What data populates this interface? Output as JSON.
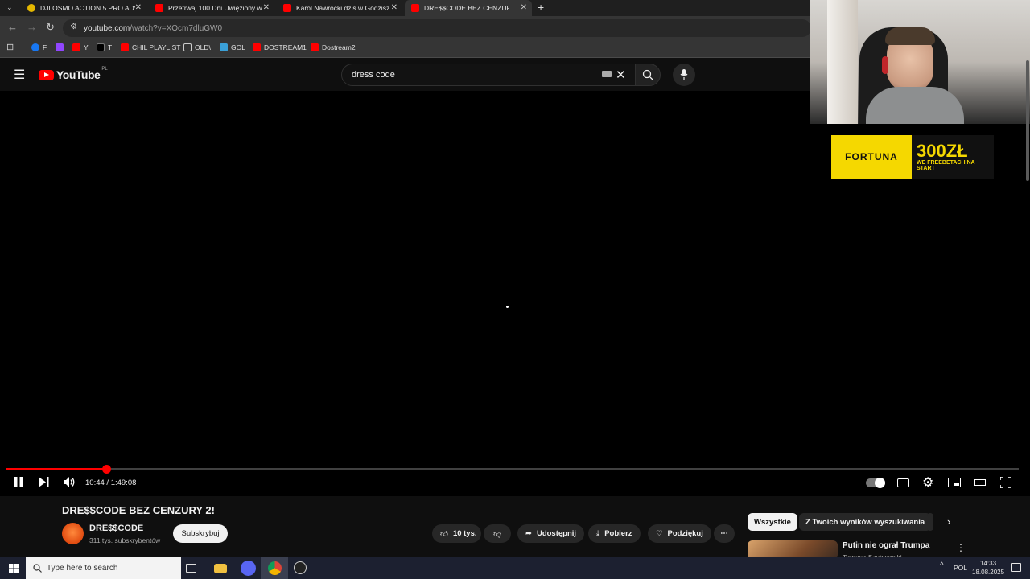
{
  "browser": {
    "tabs": [
      {
        "title": "DJI OSMO ACTION 5 PRO ADV",
        "favicon_color": "#e5b800",
        "active": false
      },
      {
        "title": "Przetrwaj 100 Dni Uwięziony w",
        "favicon_color": "#ff0000",
        "active": false
      },
      {
        "title": "Karol Nawrocki dziś w Godzisz",
        "favicon_color": "#ff0000",
        "active": false
      },
      {
        "title": "DRE$$CODE BEZ CENZURY 2!",
        "favicon_color": "#ff0000",
        "active": true
      }
    ],
    "new_tab_label": "+",
    "url_host": "youtube.com",
    "url_path": "/watch?v=XOcm7dluGW0",
    "bookmarks": [
      {
        "label": "F",
        "color": "#1877f2"
      },
      {
        "label": "",
        "color": "#9146ff"
      },
      {
        "label": "Y",
        "color": "#ff0000"
      },
      {
        "label": "T",
        "color": "#000000"
      },
      {
        "label": "CHIL PLAYLIST",
        "color": "#ff0000"
      },
      {
        "label": "OLD\\",
        "color": "folder"
      },
      {
        "label": "GOL",
        "color": "#3aa0d8"
      },
      {
        "label": "DOSTREAM1",
        "color": "#ff0000"
      },
      {
        "label": "Dostream2",
        "color": "#ff0000"
      }
    ]
  },
  "youtube": {
    "logo_text": "YouTube",
    "country": "PL",
    "search_value": "dress code"
  },
  "player": {
    "current_time": "10:44",
    "duration": "1:49:08",
    "time_display": "10:44 / 1:49:08",
    "progress_fraction": 0.0983
  },
  "video": {
    "title": "DRE$$CODE BEZ CENZURY 2!",
    "channel": "DRE$$CODE",
    "subscribers": "311 tys. subskrybentów",
    "subscribe_label": "Subskrybuj",
    "likes": "10 tys.",
    "share_label": "Udostępnij",
    "download_label": "Pobierz",
    "thanks_label": "Podziękuj"
  },
  "sidebar": {
    "chips": [
      "Wszystkie",
      "Z Twoich wyników wyszukiwania"
    ],
    "suggested_title": "Putin nie ograł Trumpa",
    "suggested_author": "Tomasz Szyblowski"
  },
  "overlay": {
    "ad_brand": "FORTUNA",
    "ad_amount": "300ZŁ",
    "ad_sub": "WE FREEBETACH NA START"
  },
  "taskbar": {
    "search_placeholder": "Type here to search",
    "language": "POL",
    "time": "14:33",
    "date": "18.08.2025"
  },
  "colors": {
    "accent": "#ff0000",
    "background": "#0f0f0f"
  }
}
